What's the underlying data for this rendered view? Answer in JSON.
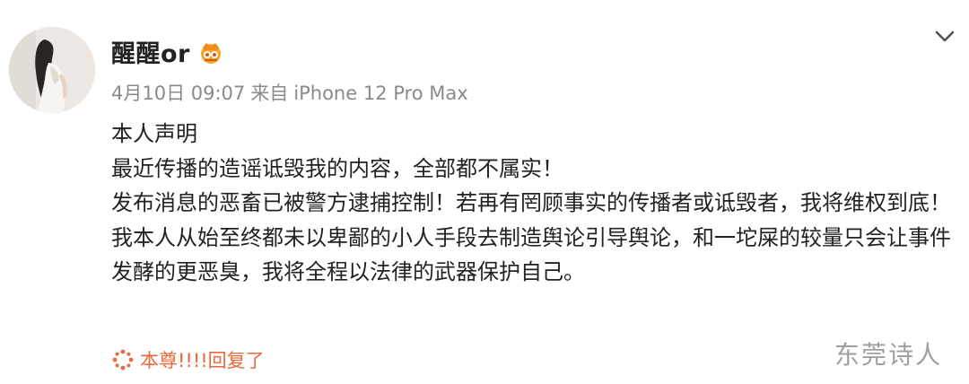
{
  "post": {
    "username": "醒醒or",
    "date": "4月10日 09:07",
    "source_prefix": "来自",
    "source_device": "iPhone 12 Pro Max",
    "paragraphs": [
      "本人声明",
      "最近传播的造谣诋毁我的内容，全部都不属实！",
      "发布消息的恶畜已被警方逮捕控制！若再有罔顾事实的传播者或诋毁者，我将维权到底！",
      "我本人从始至终都未以卑鄙的小人手段去制造舆论引导舆论，和一坨屎的较量只会让事件发酵的更恶臭，我将全程以法律的武器保护自己。"
    ],
    "reply_label": "本尊!!!!回复了"
  },
  "watermark": "东莞诗人",
  "icons": {
    "avatar": "avatar-photo",
    "vip_badge": "vip-crown-icon",
    "menu": "chevron-down-icon",
    "reply": "sparkle-icon"
  },
  "colors": {
    "reply_accent": "#e86a3a",
    "meta_gray": "#8a8a8a",
    "badge_orange": "#f5a623"
  }
}
